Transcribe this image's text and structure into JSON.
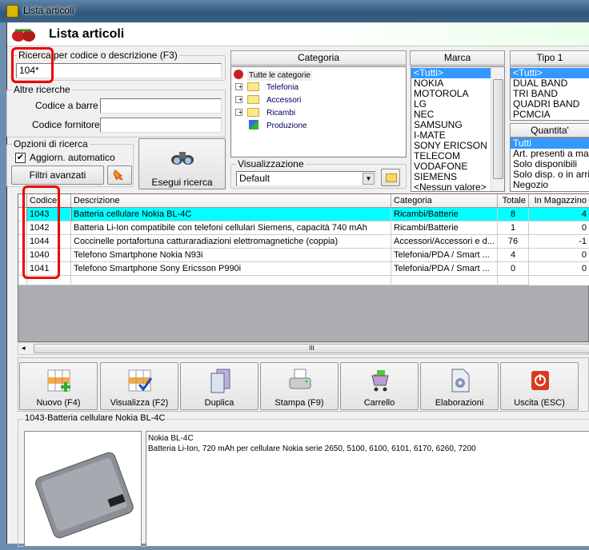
{
  "window": {
    "title": "Lista articoli"
  },
  "header": {
    "title": "Lista articoli"
  },
  "search": {
    "group_label": "Ricerca per codice o descrizione (F3)",
    "value": "104*"
  },
  "other_search": {
    "group_label": "Altre ricerche",
    "barcode_label": "Codice a barre :",
    "barcode_value": "",
    "supplier_label": "Codice fornitore :",
    "supplier_value": ""
  },
  "options": {
    "group_label": "Opzioni di ricerca",
    "auto_update_label": "Aggiorn. automatico",
    "auto_update_checked": true,
    "advanced_filters_label": "Filtri avanzati"
  },
  "run_search_label": "Esegui ricerca",
  "category": {
    "header": "Categoria",
    "items": [
      "Tutte le categorie",
      "Telefonia",
      "Accessori",
      "Ricambi",
      "Produzione"
    ]
  },
  "view": {
    "group_label": "Visualizzazione",
    "selected": "Default"
  },
  "brand": {
    "header": "Marca",
    "items": [
      "<Tutti>",
      "NOKIA",
      "MOTOROLA",
      "LG",
      "NEC",
      "SAMSUNG",
      "I-MATE",
      "SONY ERICSON",
      "TELECOM",
      "VODAFONE",
      "SIEMENS",
      "<Nessun valore>"
    ]
  },
  "type1": {
    "header": "Tipo 1",
    "items": [
      "<Tutti>",
      "DUAL BAND",
      "TRI BAND",
      "QUADRI BAND",
      "PCMCIA"
    ]
  },
  "quantity": {
    "header": "Quantita'",
    "items": [
      "Tutti",
      "Art. presenti a maga",
      "Solo disponibili",
      "Solo disp. o in arrivo",
      "Negozio"
    ]
  },
  "grid": {
    "columns": [
      "Codice",
      "Descrizione",
      "Categoria",
      "Totale",
      "In Magazzino"
    ],
    "rows": [
      [
        "1043",
        "Batteria cellulare Nokia BL-4C",
        "Ricambi/Batterie",
        "8",
        "4"
      ],
      [
        "1042",
        "Batteria Li-Ion compatibile con telefoni cellulari Siemens, capacità 740 mAh",
        "Ricambi/Batterie",
        "1",
        "0"
      ],
      [
        "1044",
        "Coccinelle portafortuna catturaradiazioni elettromagnetiche (coppia)",
        "Accessori/Accessori e d...",
        "76",
        "-1"
      ],
      [
        "1040",
        "Telefono Smartphone Nokia N93i",
        "Telefonia/PDA / Smart ...",
        "4",
        "0"
      ],
      [
        "1041",
        "Telefono Smartphone Sony Ericsson P990i",
        "Telefonia/PDA / Smart ...",
        "0",
        "0"
      ]
    ],
    "selected_color": "#00ffff"
  },
  "toolbar": {
    "new": "Nuovo (F4)",
    "view": "Visualizza (F2)",
    "duplicate": "Duplica",
    "print": "Stampa (F9)",
    "cart": "Carrello",
    "processing": "Elaborazioni",
    "exit": "Uscita (ESC)"
  },
  "detail": {
    "group_label": "1043-Batteria cellulare Nokia BL-4C",
    "name": "Nokia BL-4C",
    "description": "Batteria Li-Ion, 720 mAh per cellulare Nokia serie 2650, 5100, 6100, 6101, 6170, 6260, 7200"
  }
}
